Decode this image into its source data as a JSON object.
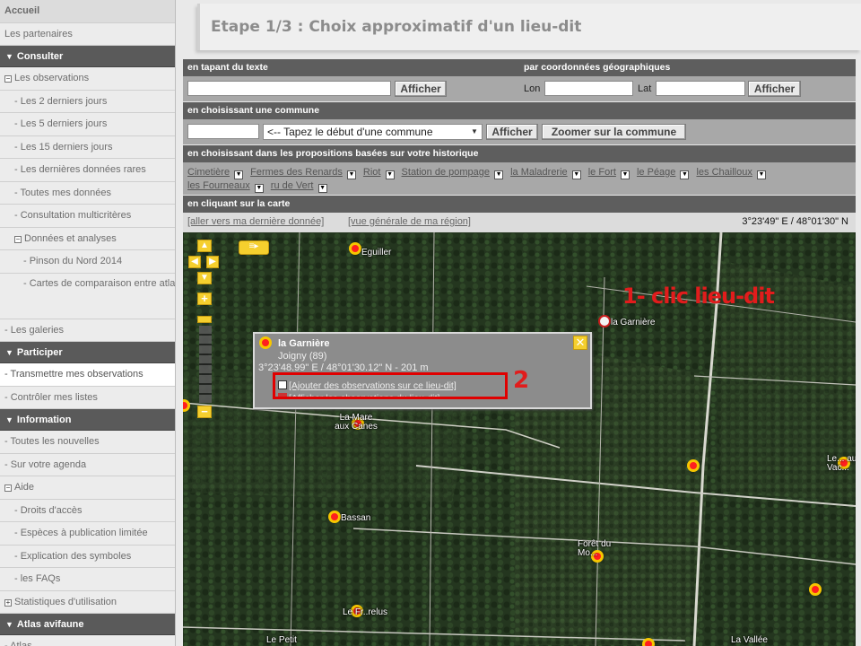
{
  "sidebar": {
    "items": [
      {
        "label": "Accueil",
        "kind": "top"
      },
      {
        "label": "Les partenaires",
        "kind": "l1"
      },
      {
        "label": "Consulter",
        "kind": "section"
      },
      {
        "label": "Les observations",
        "kind": "l1",
        "box": "−"
      },
      {
        "label": "- Les 2 derniers jours",
        "kind": "l2"
      },
      {
        "label": "- Les 5 derniers jours",
        "kind": "l2"
      },
      {
        "label": "- Les 15 derniers jours",
        "kind": "l2"
      },
      {
        "label": "- Les dernières données rares",
        "kind": "l2"
      },
      {
        "label": "- Toutes mes données",
        "kind": "l2"
      },
      {
        "label": "- Consultation multicritères",
        "kind": "l2"
      },
      {
        "label": "Données et analyses",
        "kind": "l2",
        "box": "−"
      },
      {
        "label": "- Pinson du Nord 2014",
        "kind": "l3"
      },
      {
        "label": "- Cartes de comparaison entre atlas",
        "kind": "l3",
        "two": true
      },
      {
        "label": "- Les galeries",
        "kind": "l1"
      },
      {
        "label": "Participer",
        "kind": "section"
      },
      {
        "label": "- Transmettre mes observations",
        "kind": "l1",
        "active": true
      },
      {
        "label": "- Contrôler mes listes",
        "kind": "l1"
      },
      {
        "label": "Information",
        "kind": "section"
      },
      {
        "label": "- Toutes les nouvelles",
        "kind": "l1"
      },
      {
        "label": "- Sur votre agenda",
        "kind": "l1"
      },
      {
        "label": "Aide",
        "kind": "l1",
        "box": "−"
      },
      {
        "label": "- Droits d'accès",
        "kind": "l2"
      },
      {
        "label": "- Espèces à publication limitée",
        "kind": "l2"
      },
      {
        "label": "- Explication des symboles",
        "kind": "l2"
      },
      {
        "label": "- les FAQs",
        "kind": "l2"
      },
      {
        "label": "Statistiques d'utilisation",
        "kind": "l1",
        "box": "+"
      },
      {
        "label": "Atlas avifaune",
        "kind": "section"
      },
      {
        "label": "- Atlas",
        "kind": "l1"
      }
    ]
  },
  "page": {
    "title": "Etape 1/3 : Choix approximatif d'un lieu-dit"
  },
  "search_text": {
    "header": "en tapant du texte",
    "value": "",
    "button": "Afficher"
  },
  "search_coords": {
    "header": "par coordonnées géographiques",
    "lon_label": "Lon",
    "lon_value": "",
    "lat_label": "Lat",
    "lat_value": "",
    "button": "Afficher"
  },
  "commune": {
    "header": "en choisissant une commune",
    "input_value": "",
    "select_text": "<-- Tapez le début d'une commune",
    "button": "Afficher",
    "zoom_button": "Zoomer sur la commune"
  },
  "history": {
    "header": "en choisissant dans les propositions basées sur votre historique",
    "places_line1": [
      "Cimetière",
      "Fermes des Renards",
      "Riot",
      "Station de pompage",
      "la Maladrerie",
      "le Fort",
      "le Péage",
      "les Chailloux"
    ],
    "places_line2": [
      "les Fourneaux",
      "ru de Vert"
    ]
  },
  "map_section": {
    "header": "en cliquant sur la carte",
    "link_last": "[aller vers ma dernière donnée]",
    "link_region": "[vue générale de ma région]",
    "coords_readout": "3°23'49\" E / 48°01'30\" N"
  },
  "map": {
    "labels": [
      "Eguiller",
      "la Garnière",
      "La Mare aux Canes",
      "Bassan",
      "Forêt du Mo...",
      "Le Fr..relus",
      "Le Petit",
      "La Vallée",
      "Le... aux Vac..."
    ],
    "popup": {
      "name": "la Garnière",
      "city": "Joigny (89)",
      "coords": "3°23'48.99\" E / 48°01'30.12\" N - 201 m",
      "link_add": "[Ajouter des observations sur ce lieu-dit]",
      "link_other": "[Afficher les observations du lieu-dit]",
      "close": "✕"
    }
  },
  "annotations": {
    "step1": "1- clic lieu-dit",
    "step2": "2"
  },
  "colors": {
    "section_bar": "#5e5e5e",
    "annotation_red": "#e11c1c",
    "marker_yellow": "#f6c600",
    "marker_red": "#ff1f1f"
  }
}
